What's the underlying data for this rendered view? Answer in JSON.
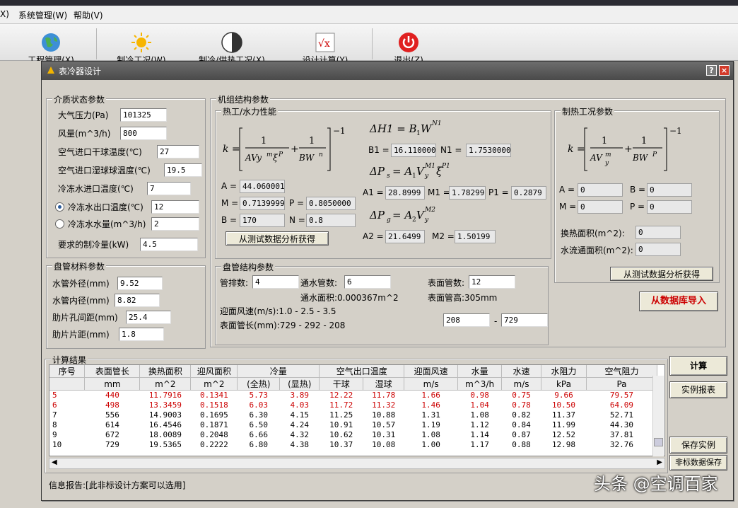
{
  "menu": [
    "X)",
    "系统管理(W)",
    "帮助(V)"
  ],
  "toolbar": [
    "工程管理(X)",
    "制冷工况(W)",
    "制冷/供热工况(X)",
    "设计计算(Y)",
    "退出(Z)"
  ],
  "dialog": {
    "title": "表冷器设计",
    "help": "?",
    "close": "×"
  },
  "medium": {
    "title": "介质状态参数",
    "fields": [
      {
        "label": "大气压力(Pa)",
        "value": "101325"
      },
      {
        "label": "风量(m^3/h)",
        "value": "800"
      },
      {
        "label": "空气进口干球温度(℃)",
        "value": "27"
      },
      {
        "label": "空气进口湿球球温度(℃)",
        "value": "19.5"
      },
      {
        "label": "冷冻水进口温度(℃)",
        "value": "7"
      },
      {
        "label": "冷冻水出口温度(℃)",
        "value": "12"
      },
      {
        "label": "冷冻水水量(m^3/h)",
        "value": "2"
      },
      {
        "label": "要求的制冷量(kW)",
        "value": "4.5"
      }
    ]
  },
  "material": {
    "title": "盘管材料参数",
    "fields": [
      {
        "label": "水管外径(mm)",
        "value": "9.52"
      },
      {
        "label": "水管内径(mm)",
        "value": "8.82"
      },
      {
        "label": "肋片孔间距(mm)",
        "value": "25.4"
      },
      {
        "label": "肋片片距(mm)",
        "value": "1.8"
      }
    ]
  },
  "structure": {
    "title": "机组结构参数",
    "thermal_title": "热工/水力性能",
    "A": "44.060001",
    "M": "0.7139999",
    "P": "0.8050000",
    "B": "170",
    "N": "0.8",
    "B1": "16.110000",
    "N1": "1.7530000",
    "A1": "28.8999",
    "M1": "1.78299",
    "P1": "0.2879",
    "A2": "21.6499",
    "M2": "1.50199",
    "analyze_btn": "从测试数据分析获得"
  },
  "coil": {
    "title": "盘管结构参数",
    "rows_label": "管排数:",
    "rows": "4",
    "water_tubes_label": "通水管数:",
    "water_tubes": "6",
    "surf_tubes_label": "表面管数:",
    "surf_tubes": "12",
    "water_area": "通水面积:0.000367m^2",
    "surf_height": "表面管高:305mm",
    "face_velocity": "迎面风速(m/s):1.0 - 2.5 - 3.5",
    "tube_length": "表面管长(mm):729 - 292 - 208",
    "range_from": "208",
    "range_dash": "-",
    "range_to": "729"
  },
  "heating": {
    "title": "制热工况参数",
    "A": "0",
    "B": "0",
    "M": "0",
    "P": "0",
    "area_label": "换热面积(m^2):",
    "area": "0",
    "flow_label": "水流通面积(m^2):",
    "flow": "0",
    "analyze_btn": "从测试数据分析获得"
  },
  "import_btn": "从数据库导入",
  "results": {
    "title": "计算结果",
    "headers1": [
      "序号",
      "表面管长",
      "换热面积",
      "迎风面积",
      "冷量",
      "空气出口温度",
      "迎面风速",
      "水量",
      "水速",
      "水阻力",
      "空气阻力"
    ],
    "headers2": [
      "",
      "mm",
      "m^2",
      "m^2",
      "(全热)",
      "(显热)",
      "干球",
      "湿球",
      "m/s",
      "m^3/h",
      "m/s",
      "kPa",
      "Pa"
    ],
    "rows": [
      [
        "5",
        "440",
        "11.7916",
        "0.1341",
        "5.73",
        "3.89",
        "12.22",
        "11.78",
        "1.66",
        "0.98",
        "0.75",
        "9.66",
        "79.57"
      ],
      [
        "6",
        "498",
        "13.3459",
        "0.1518",
        "6.03",
        "4.03",
        "11.72",
        "11.32",
        "1.46",
        "1.04",
        "0.78",
        "10.50",
        "64.09"
      ],
      [
        "7",
        "556",
        "14.9003",
        "0.1695",
        "6.30",
        "4.15",
        "11.25",
        "10.88",
        "1.31",
        "1.08",
        "0.82",
        "11.37",
        "52.71"
      ],
      [
        "8",
        "614",
        "16.4546",
        "0.1871",
        "6.50",
        "4.24",
        "10.91",
        "10.57",
        "1.19",
        "1.12",
        "0.84",
        "11.99",
        "44.30"
      ],
      [
        "9",
        "672",
        "18.0089",
        "0.2048",
        "6.66",
        "4.32",
        "10.62",
        "10.31",
        "1.08",
        "1.14",
        "0.87",
        "12.52",
        "37.81"
      ],
      [
        "10",
        "729",
        "19.5365",
        "0.2222",
        "6.80",
        "4.38",
        "10.37",
        "10.08",
        "1.00",
        "1.17",
        "0.88",
        "12.98",
        "32.76"
      ]
    ]
  },
  "buttons": {
    "calc": "计算",
    "report": "实例报表",
    "save": "保存实例",
    "nonstd": "非标数据保存"
  },
  "status": "信息报告:[此非标设计方案可以选用]",
  "watermark": "头条 @空调百家"
}
